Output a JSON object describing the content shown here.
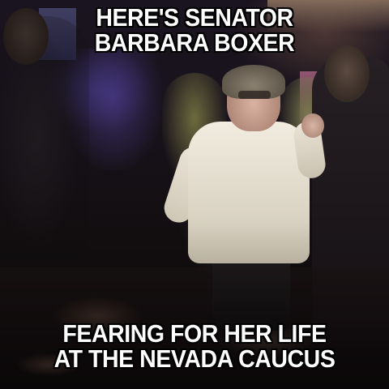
{
  "meme": {
    "top_caption": [
      "HERE'S SENATOR",
      "BARBARA BOXER"
    ],
    "bottom_caption": [
      "FEARING FOR HER LIFE",
      "AT THE NEVADA CAUCUS"
    ],
    "caption_color": "#ffffff",
    "caption_outline_color": "#000000"
  }
}
